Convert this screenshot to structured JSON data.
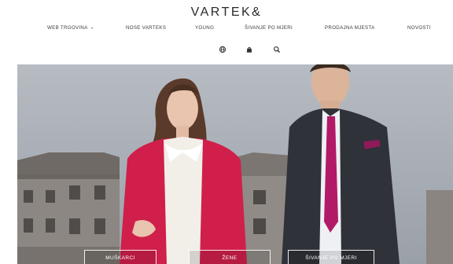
{
  "brand": {
    "logo_text": "VARTEK&"
  },
  "nav": {
    "items": [
      {
        "label": "WEB TRGOVINA",
        "has_dropdown": true
      },
      {
        "label": "NOSE VARTEKS"
      },
      {
        "label": "YOUNG"
      },
      {
        "label": "ŠIVANJE PO MJERI"
      },
      {
        "label": "PRODAJNA MJESTA"
      },
      {
        "label": "NOVOSTI"
      }
    ]
  },
  "utility_icons": [
    "globe-icon",
    "bag-icon",
    "search-icon"
  ],
  "hero": {
    "buttons": [
      {
        "label": "MUŠKARCI"
      },
      {
        "label": "ŽENE"
      },
      {
        "label": "ŠIVANJE PO MJERI"
      }
    ]
  },
  "colors": {
    "accent": "#d01f4a",
    "header_bg": "#ffffff",
    "text": "#2a2a2a"
  }
}
